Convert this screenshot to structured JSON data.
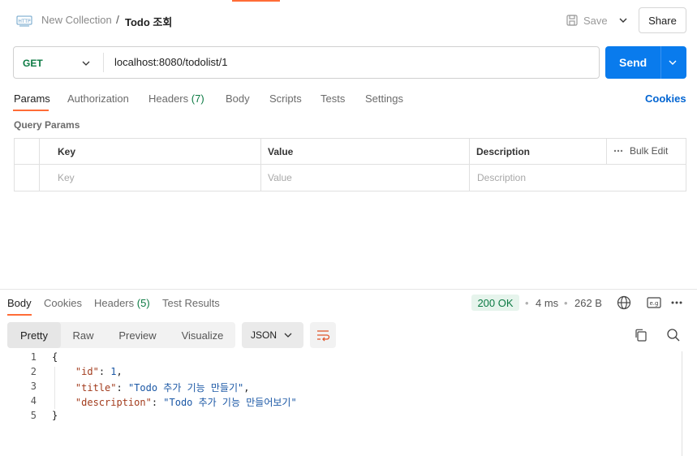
{
  "header": {
    "breadcrumb_parent": "New Collection",
    "breadcrumb_separator": "/",
    "breadcrumb_current": "Todo 조회",
    "save_label": "Save",
    "share_label": "Share"
  },
  "request": {
    "method": "GET",
    "url": "localhost:8080/todolist/1",
    "send_label": "Send"
  },
  "request_tabs": {
    "params": "Params",
    "authorization": "Authorization",
    "headers": "Headers",
    "headers_count": "(7)",
    "body": "Body",
    "scripts": "Scripts",
    "tests": "Tests",
    "settings": "Settings",
    "cookies": "Cookies"
  },
  "query_params": {
    "title": "Query Params",
    "columns": [
      "Key",
      "Value",
      "Description"
    ],
    "bulk_edit": "Bulk Edit",
    "placeholders": [
      "Key",
      "Value",
      "Description"
    ]
  },
  "response": {
    "tabs": {
      "body": "Body",
      "cookies": "Cookies",
      "headers": "Headers",
      "headers_count": "(5)",
      "test_results": "Test Results"
    },
    "status": "200 OK",
    "time": "4 ms",
    "size": "262 B",
    "formats": [
      "Pretty",
      "Raw",
      "Preview",
      "Visualize"
    ],
    "active_format": "Pretty",
    "language": "JSON",
    "lines": [
      {
        "num": "1",
        "key": "",
        "value": "",
        "prefix": "{",
        "suffix": ""
      },
      {
        "num": "2",
        "key": "\"id\"",
        "value": "1",
        "prefix": "    ",
        "suffix": ","
      },
      {
        "num": "3",
        "key": "\"title\"",
        "value": "\"Todo 추가 기능 만들기\"",
        "prefix": "    ",
        "suffix": ","
      },
      {
        "num": "4",
        "key": "\"description\"",
        "value": "\"Todo 추가 기능 만들어보기\"",
        "prefix": "    ",
        "suffix": ""
      },
      {
        "num": "5",
        "key": "",
        "value": "",
        "prefix": "}",
        "suffix": ""
      }
    ]
  },
  "colors": {
    "accent": "#ff6c37",
    "send": "#097bed",
    "method_get": "#0c7a43",
    "status_ok_bg": "#e6f4ec",
    "link": "#0265d2"
  },
  "icons": {
    "http": "http-request-icon",
    "save": "floppy-disk-icon",
    "globe": "globe-icon",
    "save_response": "save-response-icon",
    "more": "more-horizontal-icon",
    "wrap": "wrap-lines-icon",
    "copy": "copy-icon",
    "search": "search-icon"
  }
}
